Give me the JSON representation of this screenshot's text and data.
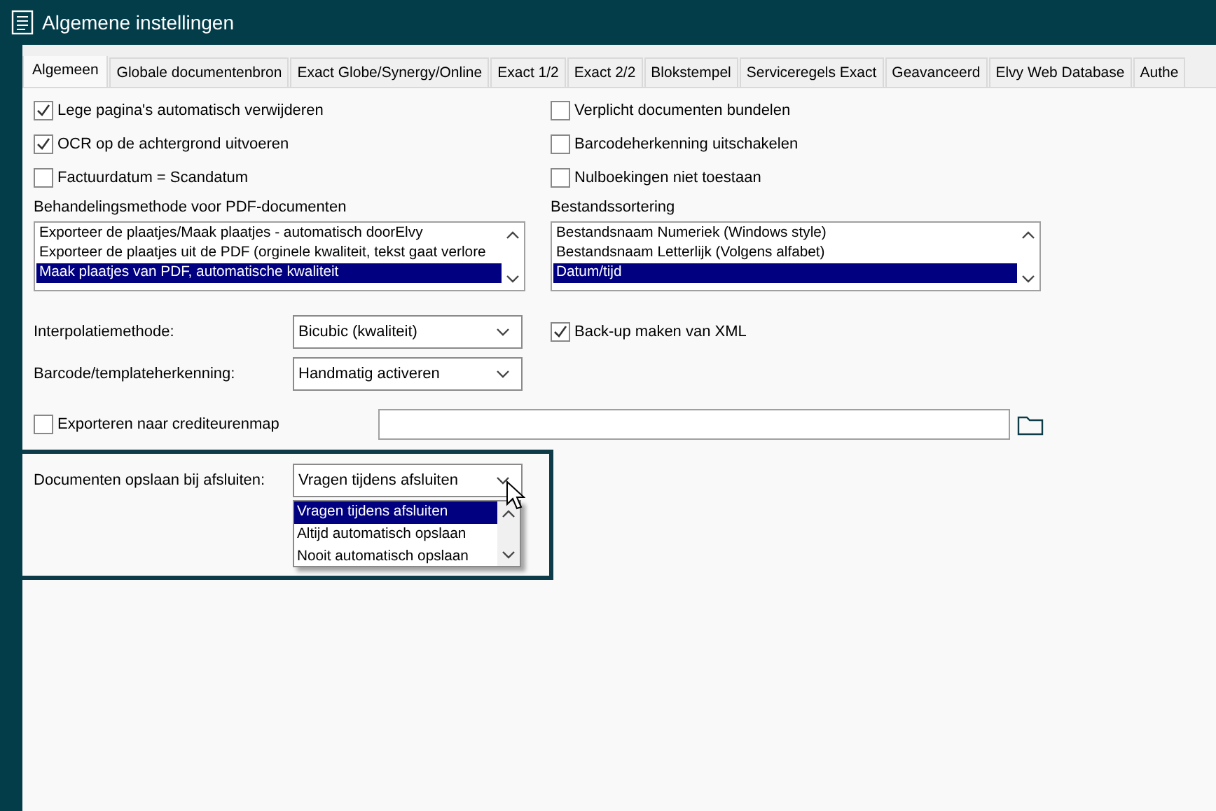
{
  "window": {
    "title": "Algemene instellingen"
  },
  "tabs": [
    {
      "label": "Algemeen",
      "selected": true
    },
    {
      "label": "Globale documentenbron",
      "selected": false
    },
    {
      "label": "Exact Globe/Synergy/Online",
      "selected": false
    },
    {
      "label": "Exact 1/2",
      "selected": false
    },
    {
      "label": "Exact 2/2",
      "selected": false
    },
    {
      "label": "Blokstempel",
      "selected": false
    },
    {
      "label": "Serviceregels Exact",
      "selected": false
    },
    {
      "label": "Geavanceerd",
      "selected": false
    },
    {
      "label": "Elvy Web Database",
      "selected": false
    },
    {
      "label": "Authe",
      "selected": false
    }
  ],
  "options_left": [
    {
      "label": "Lege pagina's automatisch verwijderen",
      "checked": true
    },
    {
      "label": "OCR op de achtergrond uitvoeren",
      "checked": true
    },
    {
      "label": "Factuurdatum = Scandatum",
      "checked": false
    }
  ],
  "options_right": [
    {
      "label": "Verplicht documenten bundelen",
      "checked": false
    },
    {
      "label": "Barcodeherkenning uitschakelen",
      "checked": false
    },
    {
      "label": "Nulboekingen niet toestaan",
      "checked": false
    }
  ],
  "pdf_method": {
    "label": "Behandelingsmethode voor PDF-documenten",
    "items": [
      {
        "text": "Exporteer de plaatjes/Maak plaatjes - automatisch doorElvy",
        "selected": false
      },
      {
        "text": "Exporteer de plaatjes uit de PDF (orginele kwaliteit, tekst gaat verlore",
        "selected": false
      },
      {
        "text": "Maak plaatjes van PDF, automatische kwaliteit",
        "selected": true
      }
    ]
  },
  "file_sorting": {
    "label": "Bestandssortering",
    "items": [
      {
        "text": "Bestandsnaam Numeriek (Windows style)",
        "selected": false
      },
      {
        "text": "Bestandsnaam Letterlijk (Volgens alfabet)",
        "selected": false
      },
      {
        "text": "Datum/tijd",
        "selected": true
      }
    ]
  },
  "interpolation": {
    "label": "Interpolatiemethode:",
    "value": "Bicubic (kwaliteit)"
  },
  "backup_xml": {
    "label": "Back-up maken van XML",
    "checked": true
  },
  "barcode": {
    "label": "Barcode/templateherkenning:",
    "value": "Handmatig activeren"
  },
  "export_creditor": {
    "label": "Exporteren naar crediteurenmap",
    "checked": false
  },
  "save_on_close": {
    "label": "Documenten opslaan bij afsluiten:",
    "value": "Vragen tijdens afsluiten",
    "highlighted": true,
    "open": true,
    "options": [
      {
        "text": "Vragen tijdens afsluiten",
        "selected": true
      },
      {
        "text": "Altijd automatisch opslaan",
        "selected": false
      },
      {
        "text": "Nooit automatisch opslaan",
        "selected": false
      }
    ]
  }
}
